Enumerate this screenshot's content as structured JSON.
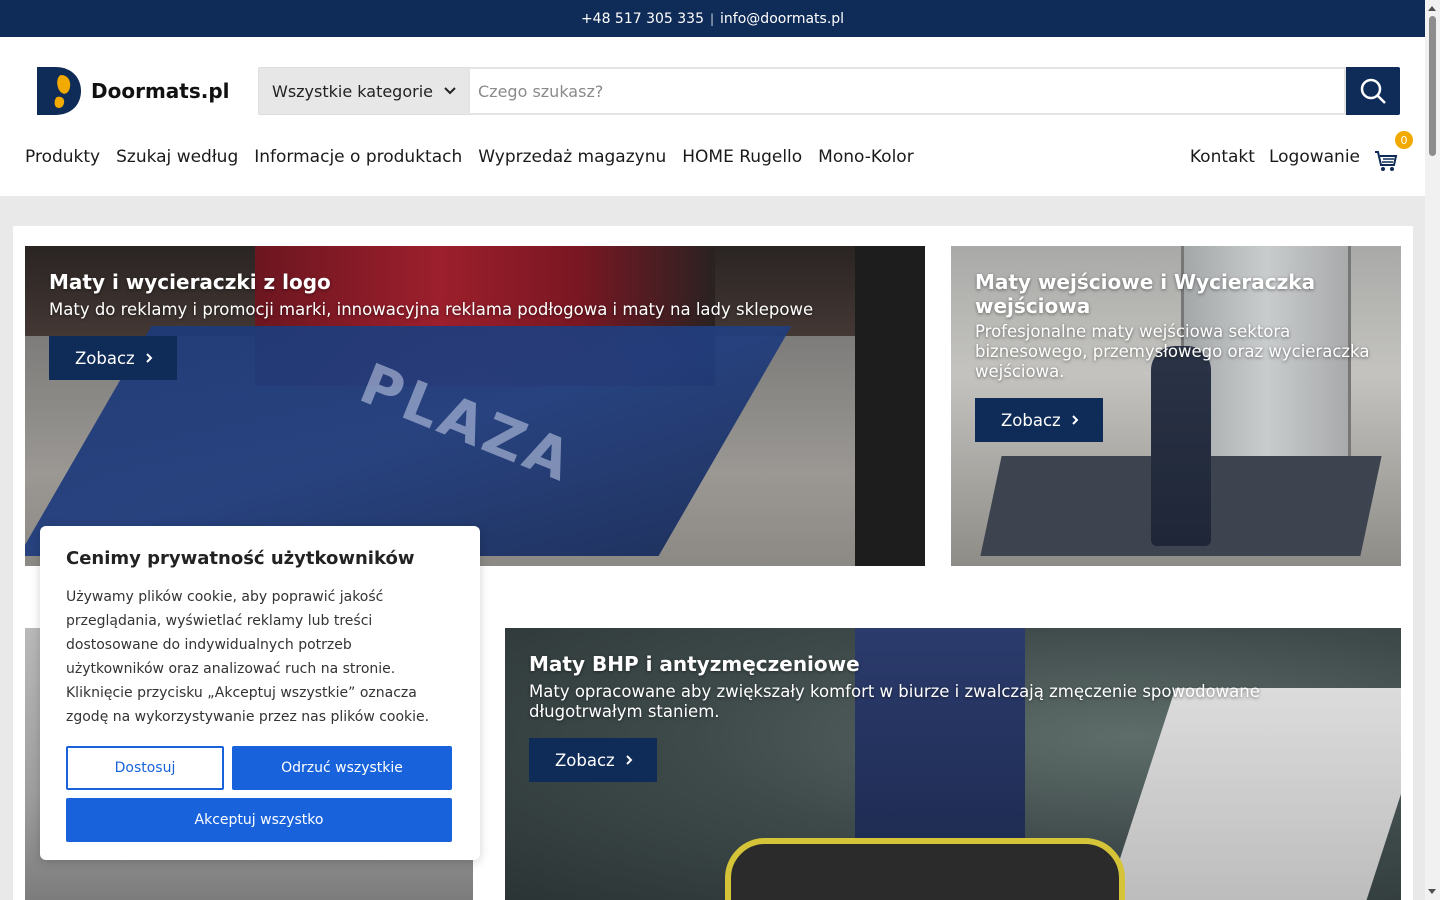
{
  "topbar": {
    "phone": "+48 517 305 335",
    "separator": "|",
    "email": "info@doormats.pl"
  },
  "brand": {
    "name": "Doormats.pl",
    "color_primary": "#0f2b57",
    "accent": "#f2a900"
  },
  "search": {
    "category": "Wszystkie kategorie",
    "placeholder": "Czego szukasz?"
  },
  "nav": {
    "items": [
      "Produkty",
      "Szukaj według",
      "Informacje o produktach",
      "Wyprzedaż magazynu",
      "HOME Rugello",
      "Mono-Kolor"
    ],
    "right": {
      "contact": "Kontakt",
      "login": "Logowanie",
      "cart_count": "0"
    }
  },
  "tiles": [
    {
      "title": "Maty i wycieraczki z logo",
      "desc": "Maty do reklamy i promocji marki, innowacyjna reklama podłogowa i maty na lady sklepowe",
      "cta": "Zobacz",
      "mat_text": "PLAZA"
    },
    {
      "title": "Maty wejściowe i Wycieraczka wejściowa",
      "desc": "Profesjonalne maty wejściowa sektora biznesowego, przemysłowego oraz wycieraczka wejściowa.",
      "cta": "Zobacz"
    },
    {
      "title": "Maty BHP i antyzmęczeniowe",
      "desc": "Maty opracowane aby zwiększały komfort w biurze i zwalczają zmęczenie spowodowane długotrwałym staniem.",
      "cta": "Zobacz"
    }
  ],
  "cookie": {
    "title": "Cenimy prywatność użytkowników",
    "text": "Używamy plików cookie, aby poprawić jakość przeglądania, wyświetlać reklamy lub treści dostosowane do indywidualnych potrzeb użytkowników oraz analizować ruch na stronie. Kliknięcie przycisku „Akceptuj wszystkie” oznacza zgodę na wykorzystywanie przez nas plików cookie.",
    "customize": "Dostosuj",
    "reject": "Odrzuć wszystkie",
    "accept": "Akceptuj wszystko",
    "button_color": "#1863dc"
  }
}
